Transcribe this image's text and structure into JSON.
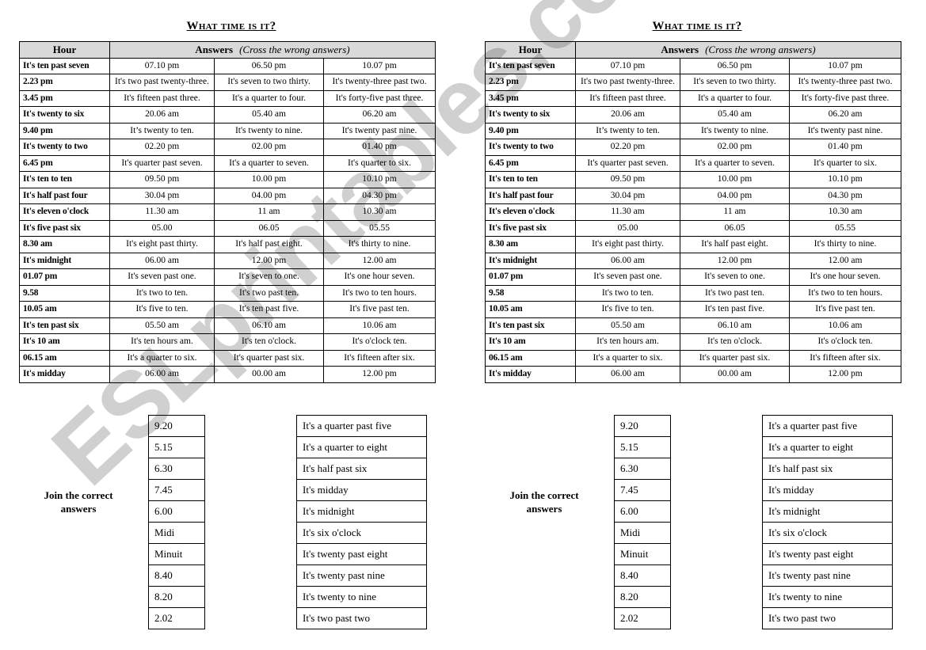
{
  "worksheet": {
    "title": "What time is it?",
    "table": {
      "header_hour": "Hour",
      "header_answers": "Answers",
      "header_hint": "(Cross the wrong answers)",
      "rows": [
        {
          "hour": "It's ten past seven",
          "answers": [
            "07.10 pm",
            "06.50 pm",
            "10.07 pm"
          ]
        },
        {
          "hour": "2.23 pm",
          "answers": [
            "It's two past twenty-three.",
            "It's seven to two thirty.",
            "It's twenty-three past two."
          ]
        },
        {
          "hour": "3.45 pm",
          "answers": [
            "It's fifteen past three.",
            "It's a quarter to four.",
            "It's forty-five past three."
          ]
        },
        {
          "hour": "It's twenty to six",
          "answers": [
            "20.06 am",
            "05.40 am",
            "06.20 am"
          ]
        },
        {
          "hour": "9.40 pm",
          "answers": [
            "It’s twenty to ten.",
            "It's twenty to nine.",
            "It's twenty past nine."
          ]
        },
        {
          "hour": "It's twenty to two",
          "answers": [
            "02.20 pm",
            "02.00 pm",
            "01.40 pm"
          ]
        },
        {
          "hour": "6.45 pm",
          "answers": [
            "It's quarter past seven.",
            "It's a quarter to seven.",
            "It's quarter to six."
          ]
        },
        {
          "hour": "It's ten to ten",
          "answers": [
            "09.50 pm",
            "10.00 pm",
            "10.10 pm"
          ]
        },
        {
          "hour": "It's half past four",
          "answers": [
            "30.04 pm",
            "04.00 pm",
            "04.30 pm"
          ]
        },
        {
          "hour": "It's eleven o'clock",
          "answers": [
            "11.30 am",
            "11 am",
            "10.30 am"
          ]
        },
        {
          "hour": "It's five past six",
          "answers": [
            "05.00",
            "06.05",
            "05.55"
          ]
        },
        {
          "hour": "8.30 am",
          "answers": [
            "It's eight past thirty.",
            "It's half past eight.",
            "It's thirty to nine."
          ]
        },
        {
          "hour": "It's midnight",
          "answers": [
            "06.00 am",
            "12.00 pm",
            "12.00 am"
          ]
        },
        {
          "hour": "01.07 pm",
          "answers": [
            "It's seven past one.",
            "It's seven to one.",
            "It's one hour seven."
          ]
        },
        {
          "hour": "9.58",
          "answers": [
            "It's two to ten.",
            "It's two past ten.",
            "It's two to ten hours."
          ]
        },
        {
          "hour": "10.05 am",
          "answers": [
            "It's five to ten.",
            "It's ten past five.",
            "It's five past ten."
          ]
        },
        {
          "hour": "It's ten past six",
          "answers": [
            "05.50 am",
            "06.10 am",
            "10.06 am"
          ]
        },
        {
          "hour": "It's 10 am",
          "answers": [
            "It's ten hours am.",
            "It's ten o'clock.",
            "It's o'clock ten."
          ]
        },
        {
          "hour": "06.15 am",
          "answers": [
            "It's a quarter to six.",
            "It's quarter past six.",
            "It's fifteen after six."
          ]
        },
        {
          "hour": "It's midday",
          "answers": [
            "06.00 am",
            "00.00 am",
            "12.00 pm"
          ]
        }
      ]
    },
    "matching": {
      "label": "Join the correct answers",
      "times": [
        "9.20",
        "5.15",
        "6.30",
        "7.45",
        "6.00",
        "Midi",
        "Minuit",
        "8.40",
        "8.20",
        "2.02"
      ],
      "phrases": [
        "It's a quarter past five",
        "It's a quarter to eight",
        "It's half past six",
        "It's midday",
        "It's midnight",
        "It's six o'clock",
        "It's twenty past eight",
        "It's twenty past nine",
        "It's twenty to nine",
        "It's two past two"
      ]
    }
  },
  "watermark": "ESLprintables.com"
}
